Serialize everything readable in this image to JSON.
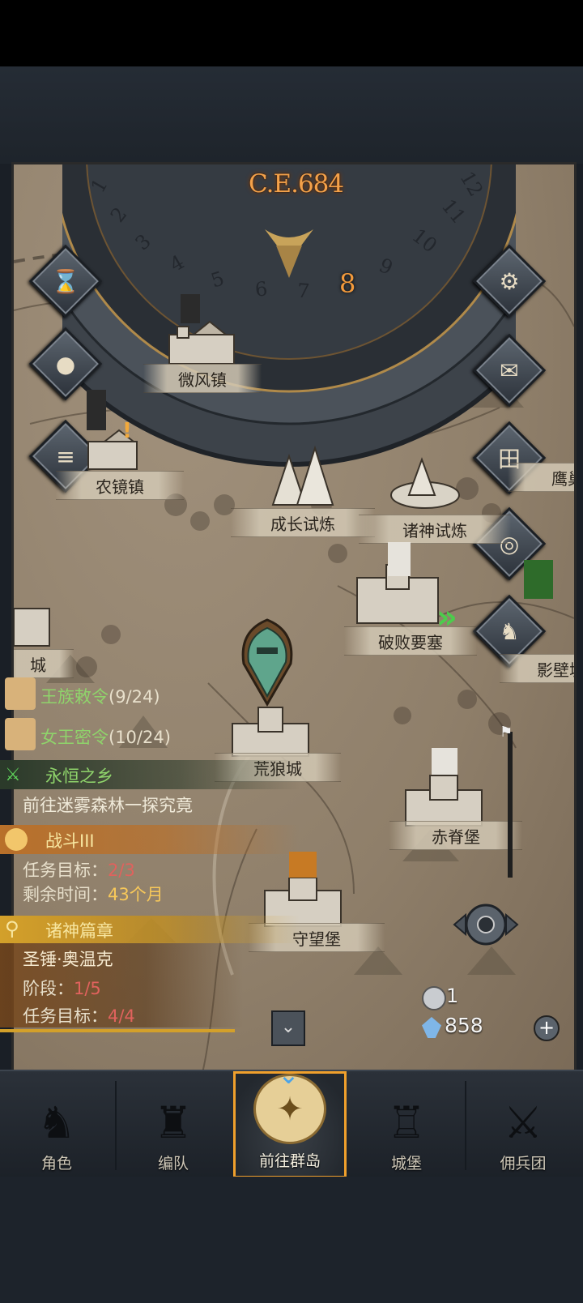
{
  "calendar": {
    "era": "C.E.684",
    "months": [
      "1",
      "2",
      "3",
      "4",
      "5",
      "6",
      "7",
      "8",
      "9",
      "10",
      "11",
      "12"
    ],
    "current_month": "8"
  },
  "side_buttons_left": [
    "hourglass-icon",
    "money-bag-icon",
    "scroll-icon"
  ],
  "side_buttons_right": [
    "gear-icon",
    "mail-icon",
    "grid-icon",
    "coin-icon",
    "knight-icon"
  ],
  "locations": {
    "weifeng": "微风镇",
    "nongjing": "农镜镇",
    "growth_trial": "成长试炼",
    "gods_trial": "诸神试炼",
    "ruined_fortress": "破败要塞",
    "eagle_nest": "鹰巢",
    "shadow_wall": "影壁城",
    "left_city": "城",
    "wasteland_wolf": "荒狼城",
    "red_ridge": "赤脊堡",
    "watch_fort": "守望堡"
  },
  "orders": [
    {
      "name": "王族敕令",
      "progress": "(9/24)"
    },
    {
      "name": "女王密令",
      "progress": "(10/24)"
    }
  ],
  "quests": {
    "main": {
      "title": "永恒之乡",
      "desc": "前往迷雾森林一探究竟"
    },
    "battle": {
      "title": "战斗III",
      "target_label": "任务目标：",
      "target_value": "2/3",
      "time_label": "剩余时间：",
      "time_value": "43个月"
    },
    "saga": {
      "title": "诸神篇章",
      "hero": "圣锤·奥温克",
      "stage_label": "阶段：",
      "stage_value": "1/5",
      "target_label": "任务目标：",
      "target_value": "4/4"
    }
  },
  "resources": {
    "silver": "1",
    "crystal": "858"
  },
  "nav": {
    "items": [
      {
        "label": "角色",
        "icon": "knight-helmet-icon"
      },
      {
        "label": "编队",
        "icon": "formation-icon"
      },
      {
        "label": "前往群岛",
        "icon": "compass-globe-icon"
      },
      {
        "label": "城堡",
        "icon": "castle-icon"
      },
      {
        "label": "佣兵团",
        "icon": "mercenary-icon"
      }
    ],
    "active_index": 2
  },
  "colors": {
    "accent_orange": "#f0a02c",
    "quest_green": "#8fd46b",
    "progress_red": "#e0625d"
  }
}
